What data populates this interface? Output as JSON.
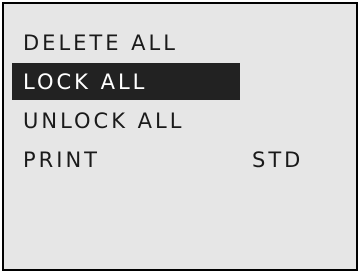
{
  "menu": {
    "items": [
      {
        "label": "DELETE ALL"
      },
      {
        "label": "LOCK ALL",
        "selected": true
      },
      {
        "label": "UNLOCK ALL"
      },
      {
        "label": "PRINT",
        "value": "STD"
      }
    ]
  }
}
